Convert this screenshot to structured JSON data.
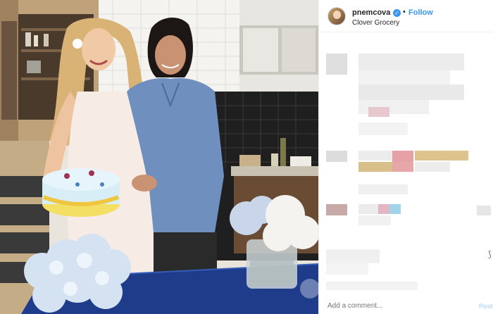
{
  "post": {
    "username": "pnemcova",
    "verified_icon": "verified-badge-icon",
    "separator": "•",
    "follow_label": "Follow",
    "location": "Clover Grocery",
    "comment_placeholder": "Add a comment...",
    "post_label": "Post"
  },
  "colors": {
    "accent": "#3897f0",
    "text": "#262626",
    "muted": "#b0b0b0"
  }
}
